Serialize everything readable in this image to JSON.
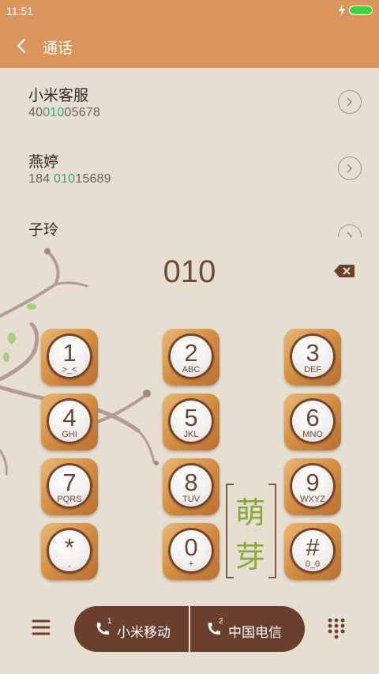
{
  "status": {
    "time": "11:51"
  },
  "header": {
    "title": "通话"
  },
  "contacts": [
    {
      "name": "小米客服",
      "num_pre": "40",
      "num_match": "010",
      "num_post": "05678"
    },
    {
      "name": "燕婷",
      "num_pre": "184 ",
      "num_match": "010",
      "num_post": "15689"
    },
    {
      "name": "子玲"
    }
  ],
  "dialer": {
    "input": "010",
    "keys": [
      {
        "digit": "1",
        "letters": ">_<"
      },
      {
        "digit": "2",
        "letters": "ABC"
      },
      {
        "digit": "3",
        "letters": "DEF"
      },
      {
        "digit": "4",
        "letters": "GHI"
      },
      {
        "digit": "5",
        "letters": "JKL"
      },
      {
        "digit": "6",
        "letters": "MNO"
      },
      {
        "digit": "7",
        "letters": "PQRS"
      },
      {
        "digit": "8",
        "letters": "TUV"
      },
      {
        "digit": "9",
        "letters": "WXYZ"
      },
      {
        "digit": "*",
        "letters": ","
      },
      {
        "digit": "0",
        "letters": "+"
      },
      {
        "digit": "#",
        "letters": "0_0"
      }
    ]
  },
  "decoration": {
    "char1": "萌",
    "char2": "芽"
  },
  "bottom": {
    "sim1_label": "小米移动",
    "sim1_index": "1",
    "sim2_label": "中国电信",
    "sim2_index": "2"
  },
  "colors": {
    "header": "#d9955b",
    "match": "#3aa86b",
    "call_pill": "#6b3f2e"
  }
}
